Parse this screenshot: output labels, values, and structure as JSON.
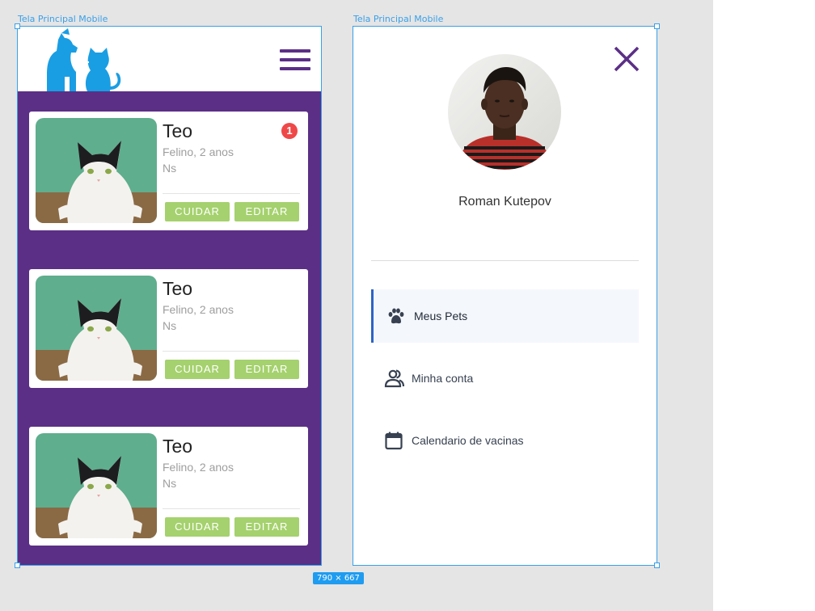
{
  "canvas": {
    "frame_left_label": "Tela Principal Mobile",
    "frame_right_label": "Tela Principal Mobile",
    "dimensions": "790 × 667"
  },
  "pets": [
    {
      "name": "Teo",
      "info": "Felino, 2 anos",
      "extra": "Ns",
      "badge": "1",
      "cuidar": "CUIDAR",
      "editar": "EDITAR"
    },
    {
      "name": "Teo",
      "info": "Felino, 2 anos",
      "extra": "Ns",
      "cuidar": "CUIDAR",
      "editar": "EDITAR"
    },
    {
      "name": "Teo",
      "info": "Felino, 2 anos",
      "extra": "Ns",
      "cuidar": "CUIDAR",
      "editar": "EDITAR"
    }
  ],
  "drawer": {
    "user_name": "Roman Kutepov",
    "menu": [
      {
        "label": "Meus Pets",
        "icon": "paw-icon",
        "active": true
      },
      {
        "label": "Minha conta",
        "icon": "users-icon",
        "active": false
      },
      {
        "label": "Calendario de vacinas",
        "icon": "calendar-icon",
        "active": false
      }
    ]
  },
  "colors": {
    "brand_purple": "#5b2f86",
    "logo_blue": "#1a9ee3",
    "button_green": "#a5d16e",
    "badge_red": "#ef4848",
    "selection_blue": "#3aa0e8",
    "active_menu_bar": "#2f63c6"
  }
}
